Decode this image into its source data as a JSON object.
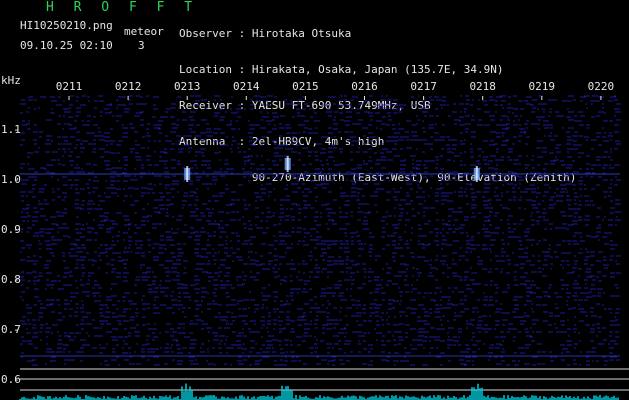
{
  "title": "H R O F F T",
  "file_name": "HI10250210.png",
  "date_time": "09.10.25 02:10",
  "meteor_label": "meteor",
  "meteor_count": "3",
  "header": {
    "observer_key": "Observer :",
    "observer": "Hirotaka Otsuka",
    "location_key": "Location :",
    "location": "Hirakata, Osaka, Japan (135.7E, 34.9N)",
    "receiver_key": "Receiver :",
    "receiver": "YAESU FT-690 53.749MHz, USB",
    "antenna_key": "Antenna  :",
    "antenna": "2el-HB9CV, 4m's high",
    "antenna_line2": "90-270-Azimuth (East-West), 90-Elevation (Zenith)"
  },
  "colors": {
    "background": "#000000",
    "title": "#2fd35a",
    "text": "#e6e6e6",
    "noise": "#1c1c9c",
    "echo": "#6ea8ff",
    "baseline": "#bfe8ff"
  },
  "chart_data": {
    "type": "heatmap",
    "y_unit": "kHz",
    "y_ticks": [
      "1.1",
      "1.0",
      "0.9",
      "0.8",
      "0.7",
      "0.6"
    ],
    "x_ticks": [
      "0211",
      "0212",
      "0213",
      "0214",
      "0215",
      "0216",
      "0217",
      "0218",
      "0219",
      "0220"
    ],
    "meteor_echoes": [
      {
        "time": "02:13.0",
        "freq_khz": 1.01
      },
      {
        "time": "02:14.7",
        "freq_khz": 1.03
      },
      {
        "time": "02:17.9",
        "freq_khz": 1.01
      }
    ]
  }
}
